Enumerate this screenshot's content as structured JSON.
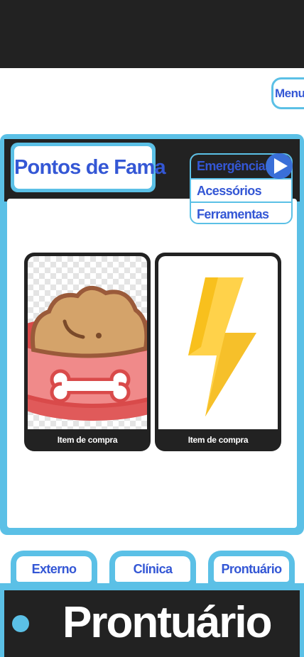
{
  "header": {
    "menu_label": "Menu"
  },
  "panel": {
    "title": "Pontos de Fama",
    "categories": [
      {
        "label": "Emergências",
        "active": true
      },
      {
        "label": "Acessórios",
        "active": false
      },
      {
        "label": "Ferramentas",
        "active": false
      }
    ],
    "play_icon": "play-icon",
    "items": [
      {
        "label": "Item de compra",
        "icon": "food-bowl-icon"
      },
      {
        "label": "Item de compra",
        "icon": "lightning-bolt-icon"
      }
    ]
  },
  "tabs": [
    {
      "label": "Externo"
    },
    {
      "label": "Clínica"
    },
    {
      "label": "Prontuário"
    }
  ],
  "footer": {
    "title": "Prontuário"
  },
  "colors": {
    "accent": "#5bc0e6",
    "text_blue": "#3457d5",
    "dark": "#222222"
  }
}
